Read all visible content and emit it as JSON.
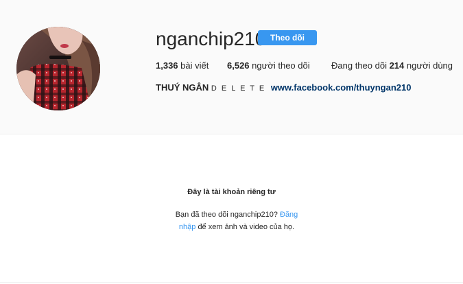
{
  "profile": {
    "username": "nganchip210",
    "follow_label": "Theo dõi",
    "stats": {
      "posts_count": "1,336",
      "posts_label": "bài viết",
      "followers_count": "6,526",
      "followers_label": "người theo dõi",
      "following_prefix": "Đang theo dõi",
      "following_count": "214",
      "following_label": "người dùng"
    },
    "bio": {
      "name": "THUÝ NGÂN",
      "tagline": "D E L E T E",
      "link": "www.facebook.com/thuyngan210"
    }
  },
  "private": {
    "title": "Đây là tài khoản riêng tư",
    "text_before": "Bạn đã theo dõi nganchip210?",
    "login_link": "Đăng nhập",
    "text_after": "để xem ảnh và video của họ."
  },
  "colors": {
    "accent": "#3897f0",
    "link_dark": "#003569",
    "header_bg": "#fafafa"
  }
}
